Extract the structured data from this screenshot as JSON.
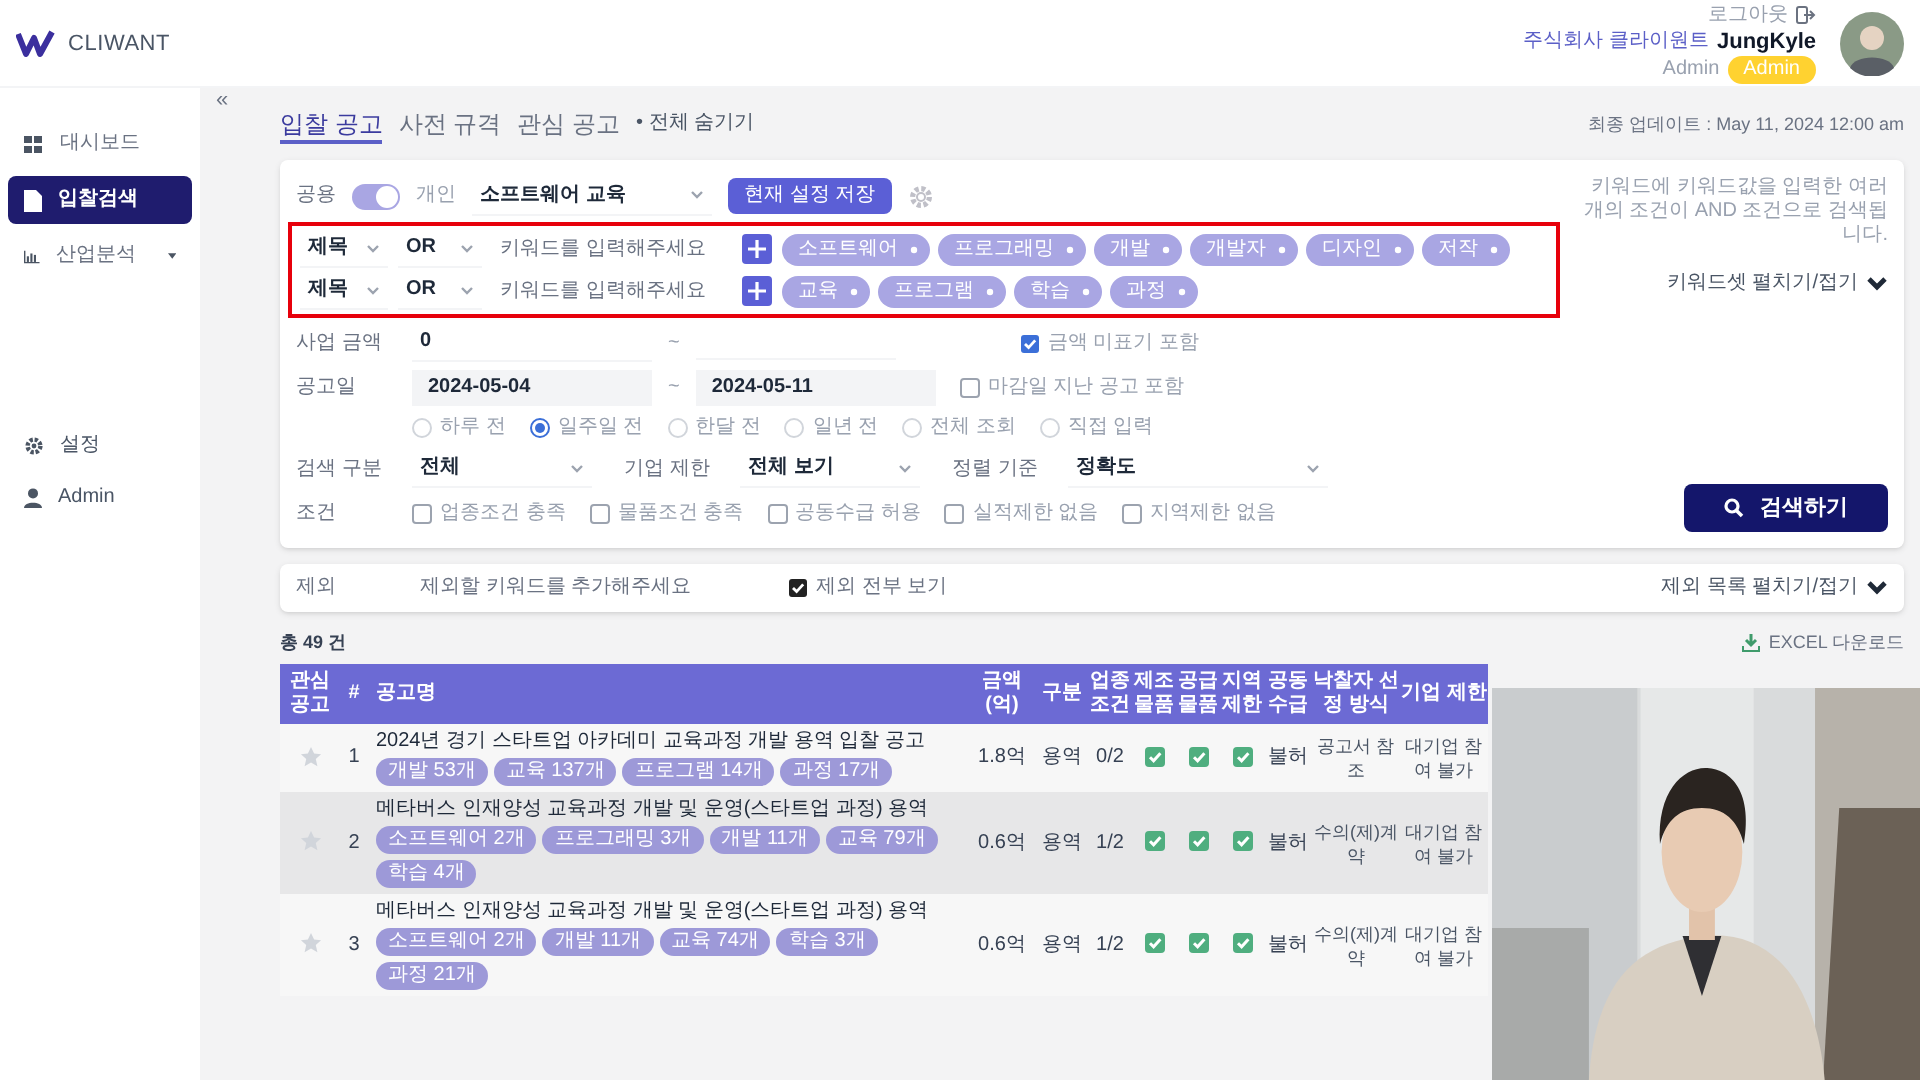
{
  "header": {
    "logo": "CLIWANT",
    "logout": "로그아웃",
    "company": "주식회사 클라이원트",
    "user": "JungKyle",
    "role": "Admin",
    "badge": "Admin"
  },
  "sidebar": {
    "collapse": "«",
    "items": [
      {
        "label": "대시보드",
        "selected": false,
        "has_submenu": false
      },
      {
        "label": "입찰검색",
        "selected": true,
        "has_submenu": false
      },
      {
        "label": "산업분석",
        "selected": false,
        "has_submenu": true
      }
    ],
    "bottom_items": [
      {
        "label": "설정"
      },
      {
        "label": "Admin"
      }
    ]
  },
  "tabs": [
    {
      "label": "입찰 공고",
      "selected": true
    },
    {
      "label": "사전 규격",
      "selected": false
    },
    {
      "label": "관심 공고",
      "selected": false
    }
  ],
  "hide_all": "• 전체 숨기기",
  "last_update": "최종 업데이트 : May 11, 2024 12:00 am",
  "filters": {
    "shared_label": "공용",
    "shared_on": true,
    "personal_label": "개인",
    "preset": "소프트웨어 교육",
    "save_button": "현재 설정 저장",
    "note": "키워드에 키워드값을 입력한 여러 개의 조건이 AND 조건으로 검색됩니다.",
    "keyword_rows_highlighted": true,
    "keyword_rows": [
      {
        "field": "제목",
        "operator": "OR",
        "placeholder": "키워드를 입력해주세요",
        "chips": [
          "소프트웨어",
          "프로그래밍",
          "개발",
          "개발자",
          "디자인",
          "저작"
        ]
      },
      {
        "field": "제목",
        "operator": "OR",
        "placeholder": "키워드를 입력해주세요",
        "chips": [
          "교육",
          "프로그램",
          "학습",
          "과정"
        ]
      }
    ],
    "keyword_toggle": "키워드셋 펼치기/접기",
    "amount": {
      "label": "사업 금액",
      "min": "0",
      "separator": "~",
      "option_label": "금액 미표기 포함",
      "option_checked": true
    },
    "date": {
      "label": "공고일",
      "from": "2024-05-04",
      "separator": "~",
      "to": "2024-05-11",
      "option_label": "마감일 지난 공고 포함",
      "option_checked": false
    },
    "ranges": [
      {
        "label": "하루 전",
        "selected": false
      },
      {
        "label": "일주일 전",
        "selected": true
      },
      {
        "label": "한달 전",
        "selected": false
      },
      {
        "label": "일년 전",
        "selected": false
      },
      {
        "label": "전체 조회",
        "selected": false
      },
      {
        "label": "직접 입력",
        "selected": false
      }
    ],
    "selects": [
      {
        "label": "검색 구분",
        "value": "전체"
      },
      {
        "label": "기업 제한",
        "value": "전체 보기"
      },
      {
        "label": "정렬 기준",
        "value": "정확도"
      }
    ],
    "conditions_label": "조건",
    "conditions": [
      {
        "label": "업종조건 충족",
        "checked": false
      },
      {
        "label": "물품조건 충족",
        "checked": false
      },
      {
        "label": "공동수급 허용",
        "checked": false
      },
      {
        "label": "실적제한 없음",
        "checked": false
      },
      {
        "label": "지역제한 없음",
        "checked": false
      }
    ],
    "search_button": "검색하기"
  },
  "exclusion": {
    "label": "제외",
    "placeholder": "제외할 키워드를 추가해주세요",
    "show_all_label": "제외 전부 보기",
    "show_all_checked": true,
    "toggle": "제외 목록 펼치기/접기"
  },
  "results": {
    "count": "총 49 건",
    "excel": "EXCEL 다운로드",
    "columns": [
      "관심 공고",
      "#",
      "공고명",
      "금액 (억)",
      "구분",
      "업종 조건",
      "제조 물품",
      "공급 물품",
      "지역 제한",
      "공동 수급",
      "낙찰자 선정 방식",
      "기업 제한"
    ],
    "rows": [
      {
        "starred": false,
        "no": "1",
        "title": "2024년 경기 스타트업 아카데미 교육과정 개발 용역 입찰 공고",
        "tags": [
          "개발 53개",
          "교육 137개",
          "프로그램 14개",
          "과정 17개"
        ],
        "amount": "1.8억",
        "type": "용역",
        "industry": "0/2",
        "manufacture": true,
        "supply": true,
        "region": true,
        "joint": "불허",
        "method": "공고서 참조",
        "company_limit": "대기업 참여 불가"
      },
      {
        "starred": false,
        "no": "2",
        "title": "메타버스 인재양성 교육과정 개발 및 운영(스타트업 과정) 용역",
        "tags": [
          "소프트웨어 2개",
          "프로그래밍 3개",
          "개발 11개",
          "교육 79개",
          "학습 4개"
        ],
        "amount": "0.6억",
        "type": "용역",
        "industry": "1/2",
        "manufacture": true,
        "supply": true,
        "region": true,
        "joint": "불허",
        "method": "수의(제)계약",
        "company_limit": "대기업 참여 불가"
      },
      {
        "starred": false,
        "no": "3",
        "title": "메타버스 인재양성 교육과정 개발 및 운영(스타트업 과정) 용역",
        "tags": [
          "소프트웨어 2개",
          "개발 11개",
          "교육 74개",
          "학습 3개",
          "과정 21개"
        ],
        "amount": "0.6억",
        "type": "용역",
        "industry": "1/2",
        "manufacture": true,
        "supply": true,
        "region": true,
        "joint": "불허",
        "method": "수의(제)계약",
        "company_limit": "대기업 참여 불가"
      }
    ]
  }
}
